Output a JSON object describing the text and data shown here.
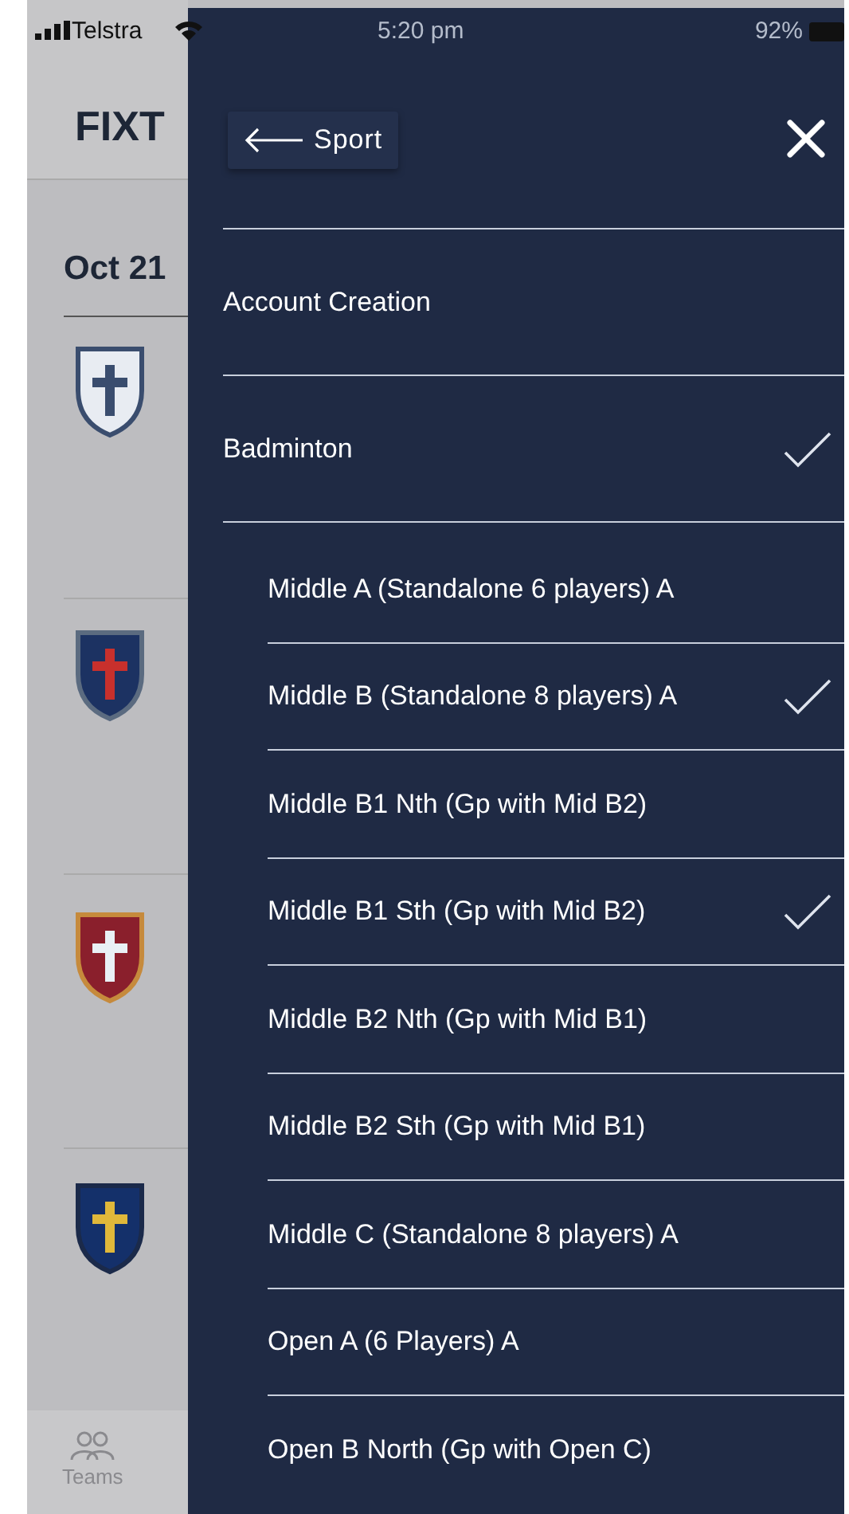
{
  "status_bar": {
    "carrier": "Telstra",
    "time": "5:20 pm",
    "battery": "92%"
  },
  "screen": {
    "title": "FIXT",
    "date": "Oct 21"
  },
  "tab_bar": {
    "items": [
      {
        "label": "Teams"
      }
    ]
  },
  "drawer": {
    "back_label": "Sport",
    "items": [
      {
        "label": "Account Creation",
        "checked": false
      },
      {
        "label": "Badminton",
        "checked": true,
        "children": [
          {
            "label": "Middle A (Standalone 6 players) A",
            "checked": false
          },
          {
            "label": "Middle B (Standalone 8 players) A",
            "checked": true
          },
          {
            "label": "Middle B1 Nth (Gp with Mid B2)",
            "checked": false
          },
          {
            "label": "Middle B1 Sth (Gp with Mid B2)",
            "checked": true
          },
          {
            "label": "Middle B2 Nth (Gp with Mid B1)",
            "checked": false
          },
          {
            "label": "Middle B2 Sth (Gp with Mid B1)",
            "checked": false
          },
          {
            "label": "Middle C (Standalone 8 players) A",
            "checked": false
          },
          {
            "label": "Open A (6 Players) A",
            "checked": false
          },
          {
            "label": "Open B North (Gp with Open C)",
            "checked": false
          }
        ]
      }
    ]
  }
}
